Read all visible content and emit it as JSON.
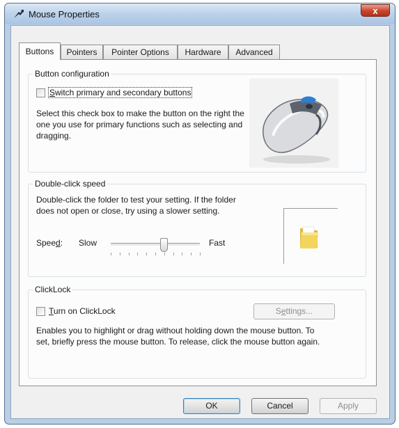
{
  "window": {
    "title": "Mouse Properties",
    "close_label": "x"
  },
  "tabs": [
    {
      "label": "Buttons",
      "active": true
    },
    {
      "label": "Pointers",
      "active": false
    },
    {
      "label": "Pointer Options",
      "active": false
    },
    {
      "label": "Hardware",
      "active": false
    },
    {
      "label": "Advanced",
      "active": false
    }
  ],
  "button_configuration": {
    "title": "Button configuration",
    "switch_checkbox": {
      "label_accel": "S",
      "label_rest": "witch primary and secondary buttons",
      "checked": false
    },
    "description": "Select this check box to make the button on the right the one you use for primary functions such as selecting and dragging."
  },
  "double_click_speed": {
    "title": "Double-click speed",
    "description": "Double-click the folder to test your setting. If the folder does not open or close, try using a slower setting.",
    "speed_label_pre": "Spee",
    "speed_label_accel": "d",
    "speed_label_post": ":",
    "slow_label": "Slow",
    "fast_label": "Fast",
    "slider_value": 0.6
  },
  "clicklock": {
    "title": "ClickLock",
    "checkbox": {
      "label_accel": "T",
      "label_rest": "urn on ClickLock",
      "checked": false
    },
    "settings_label_pre": "S",
    "settings_label_accel": "e",
    "settings_label_post": "ttings...",
    "description": "Enables you to highlight or drag without holding down the mouse button. To set, briefly press the mouse button. To release, click the mouse button again."
  },
  "footer": {
    "ok_label": "OK",
    "cancel_label": "Cancel",
    "apply_label": "Apply"
  },
  "colors": {
    "window_frame": "#b9cfe6",
    "close_button": "#c7452b",
    "panel": "#fcfcfc",
    "folder": "#f3d45c"
  }
}
